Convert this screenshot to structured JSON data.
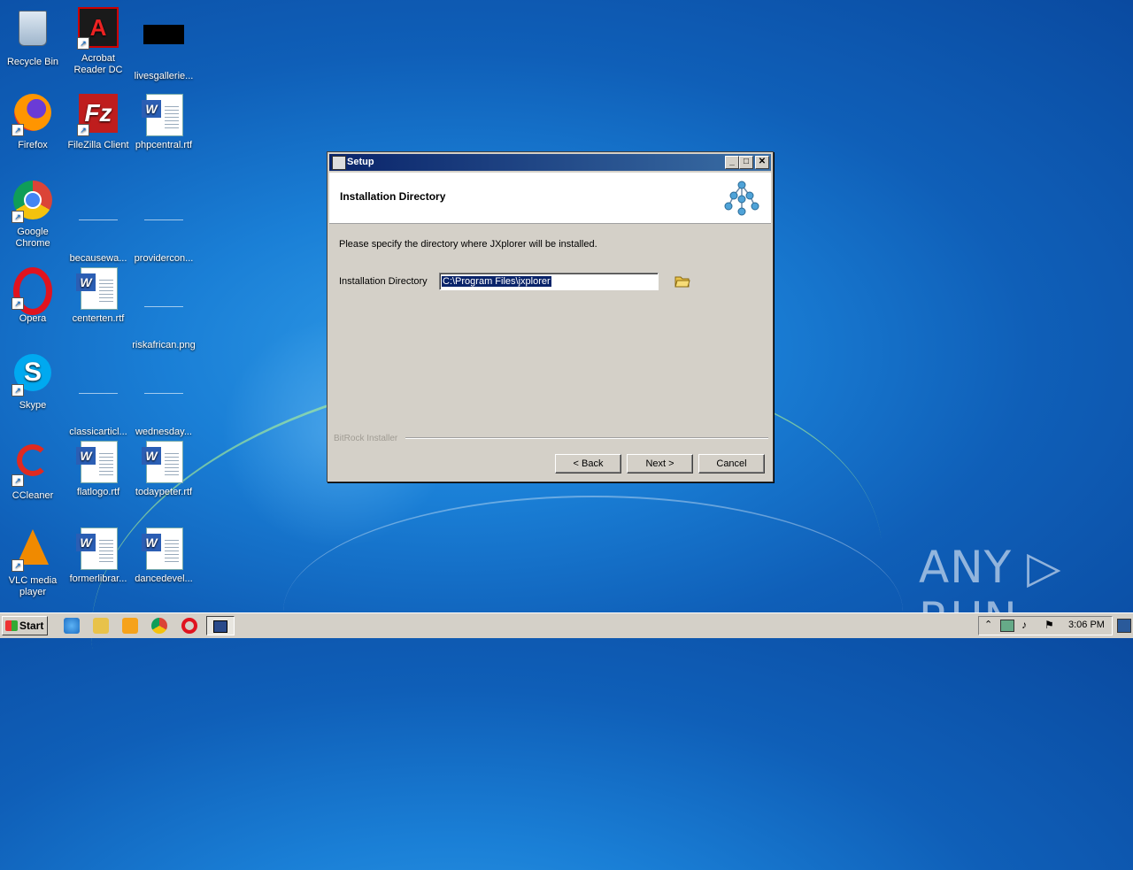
{
  "desktop": {
    "icons": [
      {
        "label": "Recycle Bin"
      },
      {
        "label": "Acrobat Reader DC"
      },
      {
        "label": "livesgallerie..."
      },
      {
        "label": "Firefox"
      },
      {
        "label": "FileZilla Client"
      },
      {
        "label": "phpcentral.rtf"
      },
      {
        "label": "Google Chrome"
      },
      {
        "label": "becausewa..."
      },
      {
        "label": "providercon..."
      },
      {
        "label": "Opera"
      },
      {
        "label": "centerten.rtf"
      },
      {
        "label": "riskafrican.png"
      },
      {
        "label": "Skype"
      },
      {
        "label": "classicarticl..."
      },
      {
        "label": "wednesday..."
      },
      {
        "label": "CCleaner"
      },
      {
        "label": "flatlogo.rtf"
      },
      {
        "label": "todaypeter.rtf"
      },
      {
        "label": "VLC media player"
      },
      {
        "label": "formerlibrar..."
      },
      {
        "label": "dancedevel..."
      }
    ]
  },
  "dialog": {
    "title": "Setup",
    "header": "Installation Directory",
    "description": "Please specify the directory where JXplorer will be installed.",
    "dir_label": "Installation Directory",
    "dir_value": "C:\\Program Files\\jxplorer",
    "brand": "BitRock Installer",
    "buttons": {
      "back": "< Back",
      "next": "Next >",
      "cancel": "Cancel"
    },
    "title_buttons": {
      "minimize": "_",
      "maximize": "□",
      "close": "✕"
    }
  },
  "taskbar": {
    "start_label": "Start",
    "clock": "3:06 PM"
  },
  "watermark": "ANY ▷ RUN"
}
